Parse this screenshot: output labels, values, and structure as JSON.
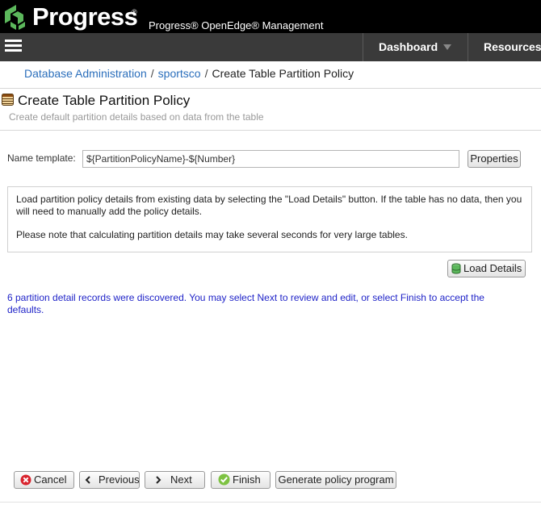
{
  "brand": {
    "logo_text": "Progress",
    "logo_registered": "®",
    "product_title": "Progress® OpenEdge® Management"
  },
  "nav": {
    "items": [
      {
        "label": "Dashboard"
      },
      {
        "label": "Resources"
      }
    ]
  },
  "breadcrumb": {
    "items": [
      "Database Administration",
      "sportsco",
      "Create Table Partition Policy"
    ],
    "separator": "/"
  },
  "page": {
    "title": "Create Table Partition Policy",
    "subtitle": "Create default partition details based on data from the table"
  },
  "form": {
    "name_template_label": "Name template:",
    "name_template_value": "${PartitionPolicyName}-${Number}",
    "properties_button": "Properties"
  },
  "info": {
    "paragraph1": "Load partition policy details from existing data by selecting the \"Load Details\" button. If the table has no data, then you will need to manually add the policy details.",
    "paragraph2": "Please note that calculating partition details may take several seconds for very large tables."
  },
  "load_details_button": "Load Details",
  "message": "6 partition detail records were discovered. You may select Next to review and edit, or select Finish to accept the defaults.",
  "footer": {
    "cancel": "Cancel",
    "previous": "Previous",
    "next": "Next",
    "finish": "Finish",
    "generate": "Generate policy program"
  },
  "colors": {
    "brand_bar": "#000000",
    "nav_bar": "#3a3a3a",
    "link": "#2a6ebb",
    "message": "#1f23c8",
    "brand_green": "#5cb85c"
  },
  "icons": {
    "logo": "progress-logo-icon",
    "menu": "hamburger-menu-icon",
    "nav_caret": "caret-down-icon",
    "page": "database-table-icon",
    "load": "database-icon",
    "cancel": "cancel-x-icon",
    "previous": "chevron-left-icon",
    "next": "chevron-right-icon",
    "finish": "check-icon"
  }
}
